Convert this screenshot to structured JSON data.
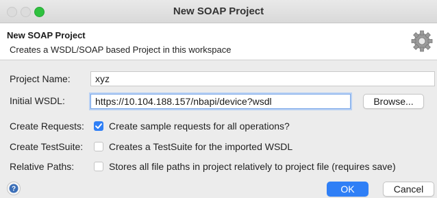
{
  "window": {
    "title": "New SOAP Project"
  },
  "header": {
    "title": "New SOAP Project",
    "description": "Creates a WSDL/SOAP based Project in this workspace",
    "icon": "gear-icon"
  },
  "form": {
    "project_name_label": "Project Name:",
    "project_name_value": "xyz",
    "initial_wsdl_label": "Initial WSDL:",
    "initial_wsdl_value": "https://10.104.188.157/nbapi/device?wsdl",
    "browse_label": "Browse...",
    "create_requests_label": "Create Requests:",
    "create_requests_text": "Create sample requests for all operations?",
    "create_requests_checked": true,
    "create_testsuite_label": "Create TestSuite:",
    "create_testsuite_text": "Creates a TestSuite for the imported WSDL",
    "create_testsuite_checked": false,
    "relative_paths_label": "Relative Paths:",
    "relative_paths_text": "Stores all file paths in project relatively to project file (requires save)",
    "relative_paths_checked": false
  },
  "footer": {
    "help_icon": "help-icon",
    "ok_label": "OK",
    "cancel_label": "Cancel"
  },
  "colors": {
    "accent": "#2f7ff6",
    "traffic_zoom": "#2fc13f"
  }
}
